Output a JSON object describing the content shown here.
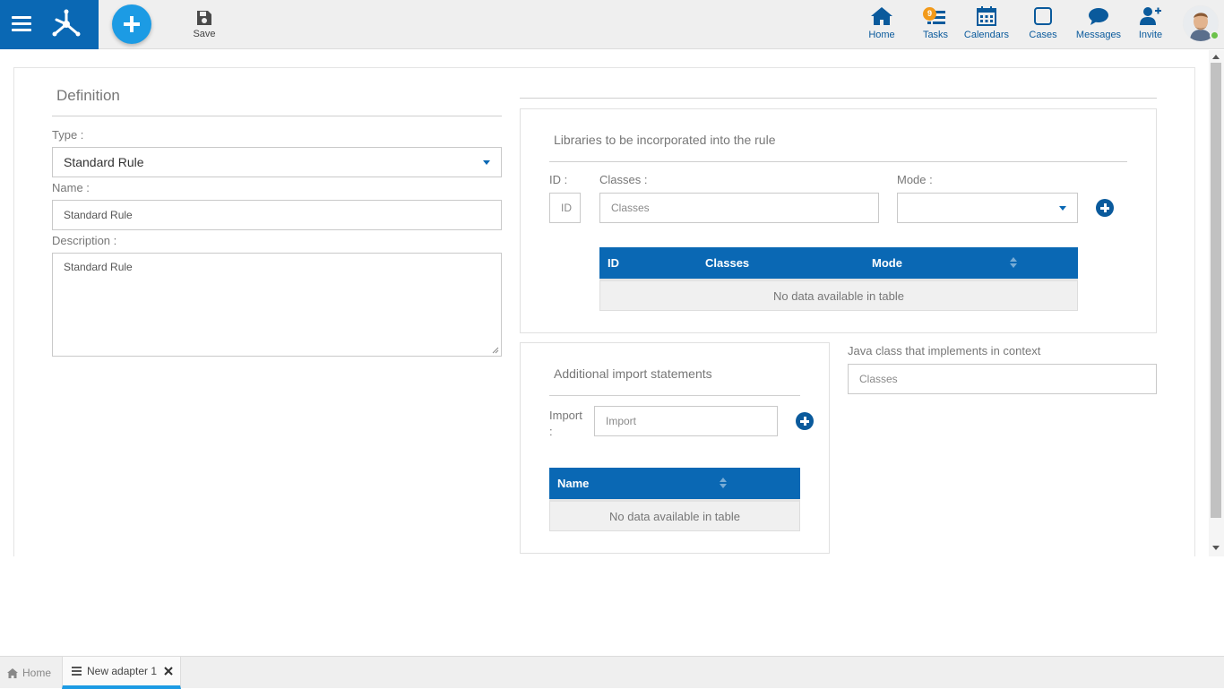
{
  "toolbar": {
    "save_label": "Save"
  },
  "nav": {
    "home": "Home",
    "tasks": "Tasks",
    "tasks_badge": "9",
    "calendars": "Calendars",
    "cases": "Cases",
    "messages": "Messages",
    "invite": "Invite"
  },
  "definition": {
    "title": "Definition",
    "type_label": "Type :",
    "type_value": "Standard Rule",
    "name_label": "Name :",
    "name_value": "Standard Rule",
    "description_label": "Description :",
    "description_value": "Standard Rule"
  },
  "libraries": {
    "title": "Libraries to be incorporated into the rule",
    "id_label": "ID :",
    "id_placeholder": "ID",
    "classes_label": "Classes :",
    "classes_placeholder": "Classes",
    "mode_label": "Mode :",
    "mode_value": "",
    "columns": [
      "ID",
      "Classes",
      "Mode"
    ],
    "empty": "No data available in table"
  },
  "imports": {
    "title": "Additional import statements",
    "import_label": "Import :",
    "import_placeholder": "Import",
    "columns": [
      "Name"
    ],
    "empty": "No data available in table"
  },
  "java": {
    "label": "Java class that implements in context",
    "placeholder": "Classes"
  },
  "tabs": [
    {
      "label": "Home"
    },
    {
      "label": "New adapter 1"
    }
  ],
  "colors": {
    "primary": "#0a68b4",
    "accent": "#1c9be4",
    "badge": "#f29a1a",
    "online": "#6cc24a"
  }
}
